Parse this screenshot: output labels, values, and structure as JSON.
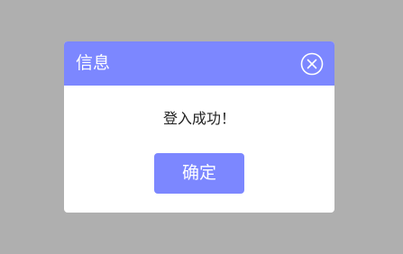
{
  "overlay": {
    "background_color": "#afafaf"
  },
  "dialog": {
    "title": "信息",
    "message": "登入成功！",
    "confirm_label": "确定",
    "close_icon": "close-circle-icon",
    "accent_color": "#7c87ff"
  }
}
